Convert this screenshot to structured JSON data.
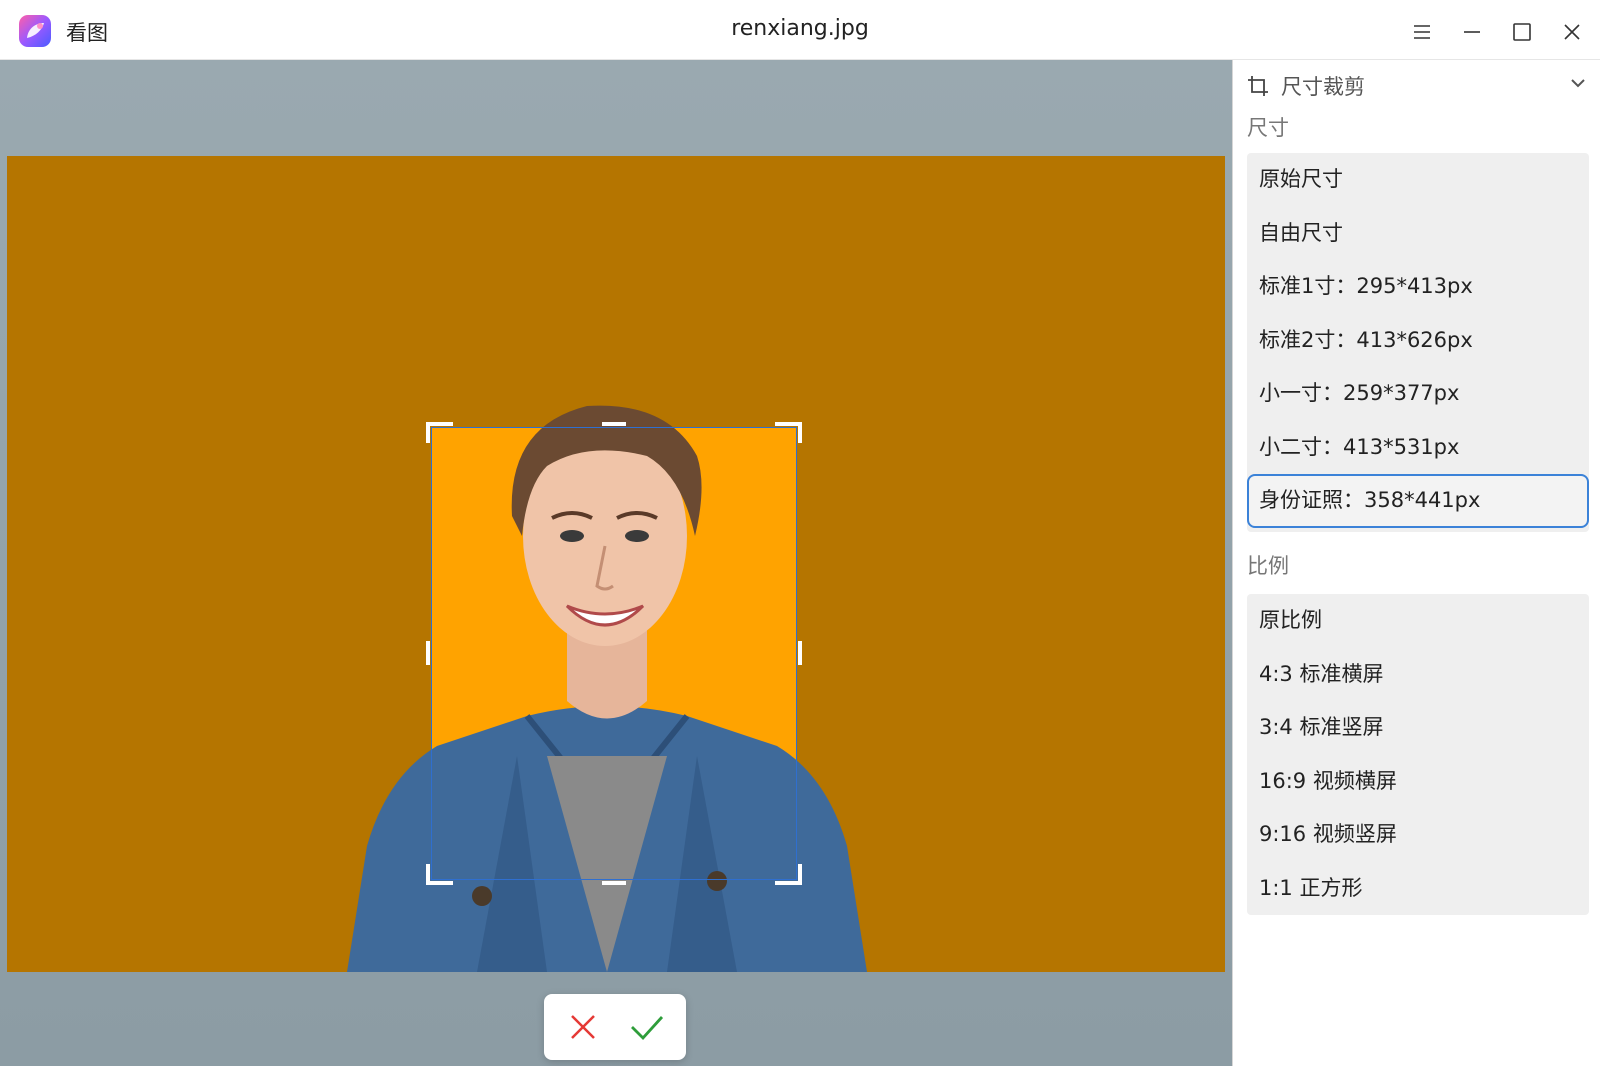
{
  "app": {
    "name": "看图",
    "file_title": "renxiang.jpg"
  },
  "window": {
    "menu": "menu-icon",
    "minimize": "minimize-icon",
    "maximize": "maximize-icon",
    "close": "close-icon"
  },
  "panel": {
    "title": "尺寸裁剪",
    "size_section": "尺寸",
    "size_items": [
      {
        "label": "原始尺寸"
      },
      {
        "label": "自由尺寸"
      },
      {
        "label": "标准1寸：295*413px"
      },
      {
        "label": "标准2寸：413*626px"
      },
      {
        "label": "小一寸：259*377px"
      },
      {
        "label": "小二寸：413*531px"
      },
      {
        "label": "身份证照：358*441px"
      }
    ],
    "selected_size": "身份证照：358*441px",
    "ratio_section": "比例",
    "ratio_items": [
      {
        "label": "原比例"
      },
      {
        "label": "4:3 标准横屏"
      },
      {
        "label": "3:4 标准竖屏"
      },
      {
        "label": "16:9 视频横屏"
      },
      {
        "label": "9:16 视频竖屏"
      },
      {
        "label": "1:1 正方形"
      }
    ]
  },
  "colors": {
    "accent": "#3b82d8",
    "photo_bg": "#ffa300",
    "cancel": "#e53935",
    "confirm": "#2e9d3a"
  }
}
